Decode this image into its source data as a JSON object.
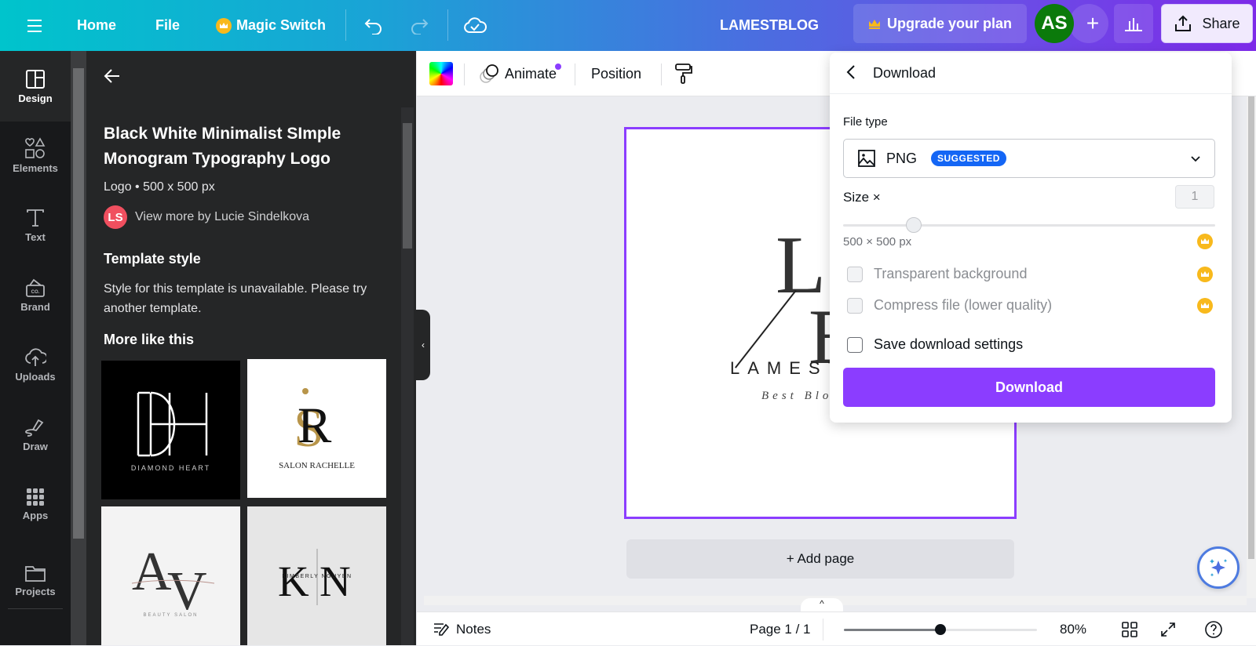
{
  "topbar": {
    "home": "Home",
    "file": "File",
    "magic_switch": "Magic Switch",
    "design_name": "LAMESTBLOG",
    "upgrade": "Upgrade your plan",
    "avatar_initials": "AS",
    "share": "Share"
  },
  "rail": {
    "items": [
      {
        "label": "Design",
        "icon": "design-icon",
        "active": true
      },
      {
        "label": "Elements",
        "icon": "elements-icon"
      },
      {
        "label": "Text",
        "icon": "text-icon"
      },
      {
        "label": "Brand",
        "icon": "brand-icon"
      },
      {
        "label": "Uploads",
        "icon": "uploads-icon"
      },
      {
        "label": "Draw",
        "icon": "draw-icon"
      },
      {
        "label": "Apps",
        "icon": "apps-icon"
      },
      {
        "label": "Projects",
        "icon": "folder-icon"
      }
    ]
  },
  "panel": {
    "title": "Black White Minimalist SImple Monogram Typography Logo",
    "meta": "Logo • 500 x 500 px",
    "author_initials": "LS",
    "author_link": "View more by Lucie Sindelkova",
    "style_heading": "Template style",
    "style_desc": "Style for this template is unavailable. Please try another template.",
    "more_heading": "More like this",
    "thumbnails": [
      {
        "name": "DIAMOND HEART",
        "monogram": "DH"
      },
      {
        "name": "SALON RACHELLE",
        "monogram": "SR"
      },
      {
        "name": "BEAUTY SALON",
        "monogram": "AV"
      },
      {
        "name": "KIMBERLY NGUYEN",
        "monogram": "KN"
      }
    ]
  },
  "context_bar": {
    "animate": "Animate",
    "position": "Position"
  },
  "canvas": {
    "logo_letter_1": "L",
    "logo_letter_2": "B",
    "brand_text": "LAMESTBLOG",
    "tagline": "Best Blog",
    "add_page": "+ Add page"
  },
  "footer": {
    "notes": "Notes",
    "page": "Page 1 / 1",
    "zoom_level": "80%",
    "zoom_fraction": 0.5
  },
  "download": {
    "title": "Download",
    "file_type_label": "File type",
    "file_type_value": "PNG",
    "file_type_badge": "SUGGESTED",
    "size_label": "Size ×",
    "size_value": "1",
    "size_fraction": 0.19,
    "dimensions": "500 × 500 px",
    "transparent_bg": "Transparent background",
    "compress": "Compress file (lower quality)",
    "save_settings": "Save download settings",
    "button": "Download"
  },
  "colors": {
    "accent": "#8b3dff",
    "badge_blue": "#1466f5",
    "crown": "#f8b91c",
    "avatar_green": "#0b7a0b"
  }
}
